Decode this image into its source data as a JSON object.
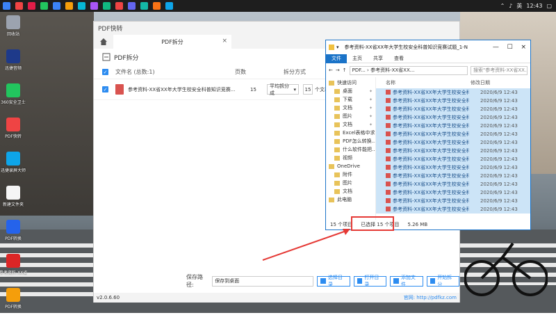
{
  "taskbar": {
    "time": "12:43",
    "ime": "英",
    "icon_colors": [
      "#3b82f6",
      "#ef4444",
      "#e11d48",
      "#22c55e",
      "#3b82f6",
      "#f59e0b",
      "#06b6d4",
      "#a855f7",
      "#10b981",
      "#ef4444",
      "#6366f1",
      "#14b8a6",
      "#f97316",
      "#0ea5e9"
    ]
  },
  "desktop_icons": [
    {
      "label": "回收站",
      "color": "#9ca3af"
    },
    {
      "label": "迅捷音频",
      "color": "#1e3a8a"
    },
    {
      "label": "360安全卫士",
      "color": "#22c55e"
    },
    {
      "label": "PDF快转",
      "color": "#ef4444"
    },
    {
      "label": "迅捷录屏大师",
      "color": "#0ea5e9"
    },
    {
      "label": "新建文件夹",
      "color": "#f5f5f5"
    },
    {
      "label": "PDF转换",
      "color": "#2563eb"
    },
    {
      "label": "参考资料-XX省",
      "color": "#dc2626"
    },
    {
      "label": "PDF转换",
      "color": "#f59e0b"
    }
  ],
  "app": {
    "title": "PDF快转",
    "tab_label": "PDF拆分",
    "toolbar_label": "PDF拆分",
    "columns": {
      "filename": "文件名 (总数:1)",
      "pages": "页数",
      "split_mode": "拆分方式"
    },
    "row": {
      "filename": "参考资料-XX省XX年大学生校安全科普知识竞赛...",
      "pages": "15",
      "split_mode": "平均拆分成",
      "parts": "15",
      "unit": "个文档"
    },
    "save_path_label": "保存路径:",
    "save_path_value": "保存到桌面",
    "buttons": {
      "choose_dir": "选择目录",
      "open_dir": "打开目录",
      "add_file": "添加文件",
      "start_split": "开始拆分"
    },
    "version": "v2.0.6.60",
    "website": "官网: http://pdfkz.com"
  },
  "explorer": {
    "title": "参考资料-XX省XX年大学生校安全科普知识竞赛试题_1-N",
    "ribbon": {
      "file": "文件",
      "home": "主页",
      "share": "共享",
      "view": "查看"
    },
    "address": "PDF... › 参考资料-XX省XX...",
    "search_placeholder": "搜索\"参考资料-XX省XX...\"",
    "nav": [
      {
        "label": "快速访问",
        "sub": false,
        "pin": false
      },
      {
        "label": "桌面",
        "sub": true,
        "pin": true
      },
      {
        "label": "下载",
        "sub": true,
        "pin": true
      },
      {
        "label": "文档",
        "sub": true,
        "pin": true
      },
      {
        "label": "图片",
        "sub": true,
        "pin": true
      },
      {
        "label": "文档",
        "sub": true,
        "pin": true
      },
      {
        "label": "Excel表格中求...",
        "sub": true,
        "pin": false
      },
      {
        "label": "PDF怎么转换...",
        "sub": true,
        "pin": false
      },
      {
        "label": "什么软件能把...",
        "sub": true,
        "pin": false
      },
      {
        "label": "视频",
        "sub": true,
        "pin": false
      },
      {
        "label": "OneDrive",
        "sub": false,
        "pin": false
      },
      {
        "label": "附件",
        "sub": true,
        "pin": false
      },
      {
        "label": "图片",
        "sub": true,
        "pin": false
      },
      {
        "label": "文档",
        "sub": true,
        "pin": false
      },
      {
        "label": "此电脑",
        "sub": false,
        "pin": false
      }
    ],
    "col_name": "名称",
    "col_date": "修改日期",
    "file_name": "参考资料-XX省XX年大学生校安全科普...",
    "file_date": "2020/6/9 12:43",
    "file_count": 15,
    "status_items": "15 个项目",
    "status_selected": "已选择 15 个项目",
    "status_size": "5.26 MB"
  }
}
